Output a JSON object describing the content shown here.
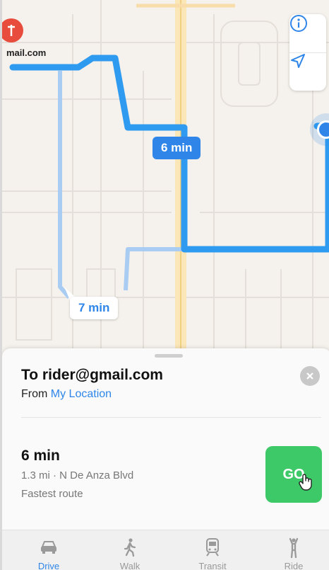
{
  "map": {
    "pin_label": "mail.com",
    "primary_route_time": "6 min",
    "alternate_route_time": "7 min",
    "controls": [
      {
        "name": "info-icon"
      },
      {
        "name": "location-arrow-icon"
      }
    ]
  },
  "sheet": {
    "destination_title": "To rider@gmail.com",
    "from_prefix": "From",
    "from_location": "My Location",
    "route": {
      "time": "6 min",
      "detail": "1.3 mi · N De Anza Blvd",
      "description": "Fastest route"
    },
    "go_label": "GO"
  },
  "tabs": [
    {
      "label": "Drive",
      "icon": "car-icon",
      "active": true
    },
    {
      "label": "Walk",
      "icon": "walk-icon",
      "active": false
    },
    {
      "label": "Transit",
      "icon": "train-icon",
      "active": false
    },
    {
      "label": "Ride",
      "icon": "ride-icon",
      "active": false
    }
  ],
  "colors": {
    "accent": "#2f86e8",
    "go": "#3ec968",
    "pin": "#e74c3c"
  }
}
